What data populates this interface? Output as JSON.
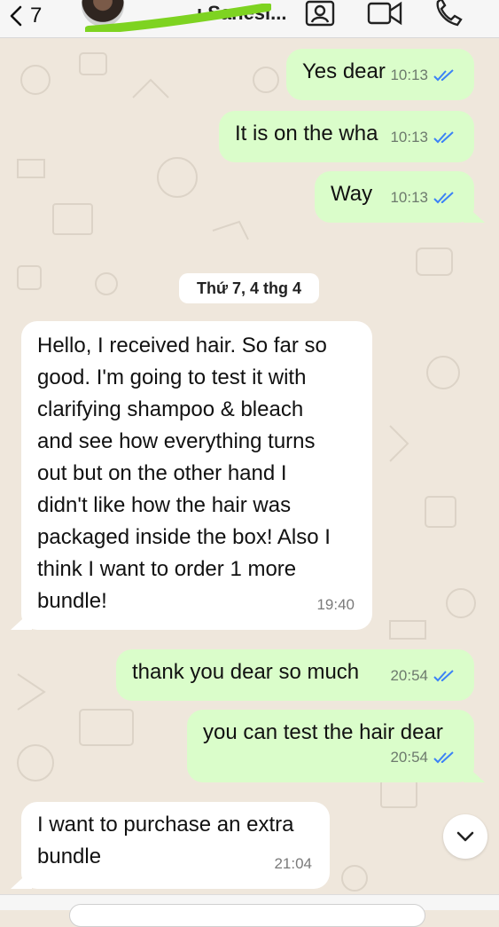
{
  "header": {
    "back_count": "7",
    "contact_name": "…ı Sanesi...",
    "icons": [
      "chevron-left-icon",
      "contact-card-icon",
      "video-call-icon",
      "phone-icon"
    ]
  },
  "date_separator": "Thứ 7, 4 thg 4",
  "messages": [
    {
      "direction": "out",
      "text": "Yes dear",
      "time": "10:13",
      "status": "read"
    },
    {
      "direction": "out",
      "text": "It is on the wha",
      "time": "10:13",
      "status": "read"
    },
    {
      "direction": "out",
      "text": "Way",
      "time": "10:13",
      "status": "read"
    },
    {
      "direction": "in",
      "text": "Hello, I received hair. So far so\ngood. I'm going to test it with\nclarifying shampoo & bleach\nand see how everything turns\nout but on the other hand I\ndidn't like how the hair was\npackaged inside the box! Also I\nthink I want to order 1 more\nbundle!",
      "time": "19:40"
    },
    {
      "direction": "out",
      "text": "thank you dear so much",
      "time": "20:54",
      "status": "read"
    },
    {
      "direction": "out",
      "text": "you can test the hair dear",
      "time": "20:54",
      "status": "read"
    },
    {
      "direction": "in",
      "text": "I want to purchase an extra\nbundle",
      "time": "21:04"
    }
  ],
  "colors": {
    "outgoing_bubble": "#dafdca",
    "incoming_bubble": "#ffffff",
    "read_ticks": "#3b82f6",
    "redaction_scribble": "#7ed321"
  }
}
